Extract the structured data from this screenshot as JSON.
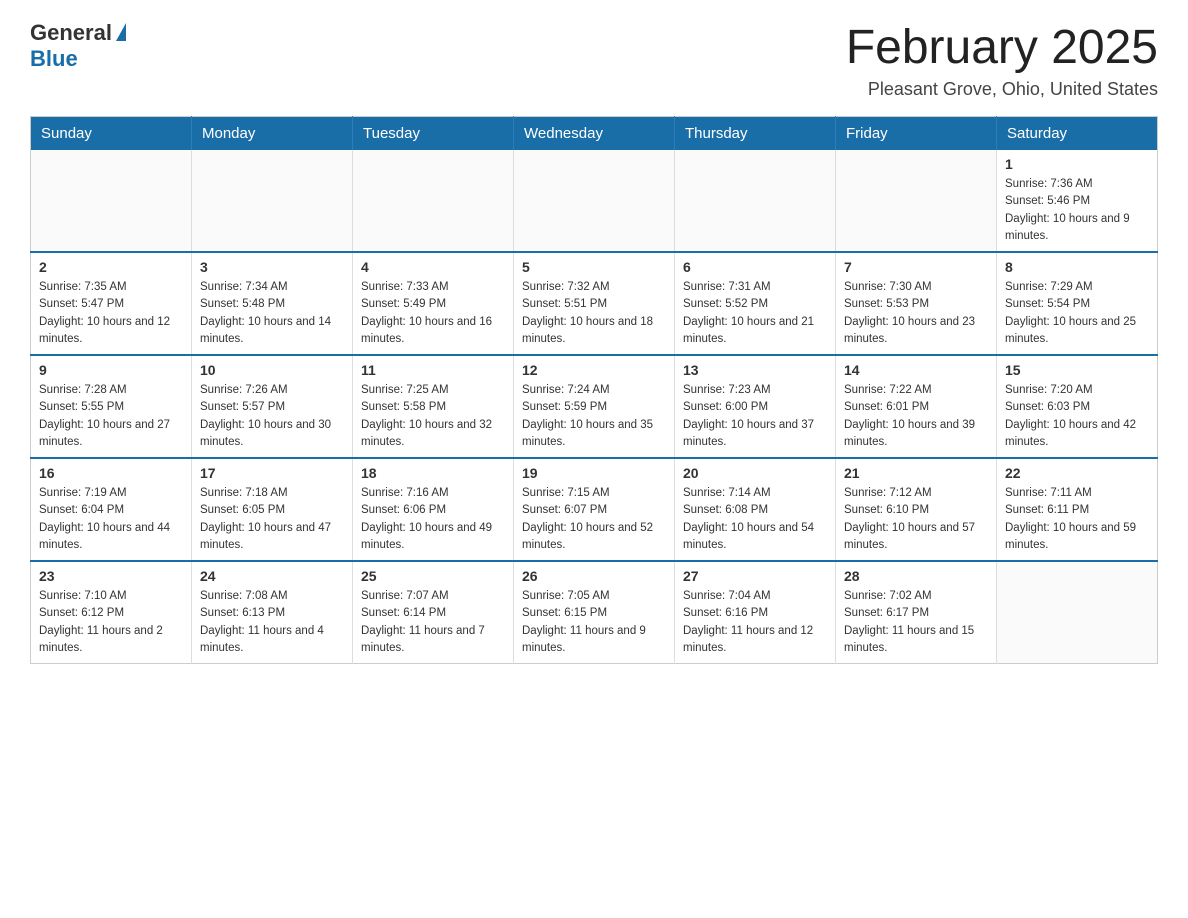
{
  "header": {
    "logo_general": "General",
    "logo_blue": "Blue",
    "title": "February 2025",
    "location": "Pleasant Grove, Ohio, United States"
  },
  "days_of_week": [
    "Sunday",
    "Monday",
    "Tuesday",
    "Wednesday",
    "Thursday",
    "Friday",
    "Saturday"
  ],
  "weeks": [
    {
      "days": [
        {
          "num": "",
          "info": ""
        },
        {
          "num": "",
          "info": ""
        },
        {
          "num": "",
          "info": ""
        },
        {
          "num": "",
          "info": ""
        },
        {
          "num": "",
          "info": ""
        },
        {
          "num": "",
          "info": ""
        },
        {
          "num": "1",
          "info": "Sunrise: 7:36 AM\nSunset: 5:46 PM\nDaylight: 10 hours and 9 minutes."
        }
      ]
    },
    {
      "days": [
        {
          "num": "2",
          "info": "Sunrise: 7:35 AM\nSunset: 5:47 PM\nDaylight: 10 hours and 12 minutes."
        },
        {
          "num": "3",
          "info": "Sunrise: 7:34 AM\nSunset: 5:48 PM\nDaylight: 10 hours and 14 minutes."
        },
        {
          "num": "4",
          "info": "Sunrise: 7:33 AM\nSunset: 5:49 PM\nDaylight: 10 hours and 16 minutes."
        },
        {
          "num": "5",
          "info": "Sunrise: 7:32 AM\nSunset: 5:51 PM\nDaylight: 10 hours and 18 minutes."
        },
        {
          "num": "6",
          "info": "Sunrise: 7:31 AM\nSunset: 5:52 PM\nDaylight: 10 hours and 21 minutes."
        },
        {
          "num": "7",
          "info": "Sunrise: 7:30 AM\nSunset: 5:53 PM\nDaylight: 10 hours and 23 minutes."
        },
        {
          "num": "8",
          "info": "Sunrise: 7:29 AM\nSunset: 5:54 PM\nDaylight: 10 hours and 25 minutes."
        }
      ]
    },
    {
      "days": [
        {
          "num": "9",
          "info": "Sunrise: 7:28 AM\nSunset: 5:55 PM\nDaylight: 10 hours and 27 minutes."
        },
        {
          "num": "10",
          "info": "Sunrise: 7:26 AM\nSunset: 5:57 PM\nDaylight: 10 hours and 30 minutes."
        },
        {
          "num": "11",
          "info": "Sunrise: 7:25 AM\nSunset: 5:58 PM\nDaylight: 10 hours and 32 minutes."
        },
        {
          "num": "12",
          "info": "Sunrise: 7:24 AM\nSunset: 5:59 PM\nDaylight: 10 hours and 35 minutes."
        },
        {
          "num": "13",
          "info": "Sunrise: 7:23 AM\nSunset: 6:00 PM\nDaylight: 10 hours and 37 minutes."
        },
        {
          "num": "14",
          "info": "Sunrise: 7:22 AM\nSunset: 6:01 PM\nDaylight: 10 hours and 39 minutes."
        },
        {
          "num": "15",
          "info": "Sunrise: 7:20 AM\nSunset: 6:03 PM\nDaylight: 10 hours and 42 minutes."
        }
      ]
    },
    {
      "days": [
        {
          "num": "16",
          "info": "Sunrise: 7:19 AM\nSunset: 6:04 PM\nDaylight: 10 hours and 44 minutes."
        },
        {
          "num": "17",
          "info": "Sunrise: 7:18 AM\nSunset: 6:05 PM\nDaylight: 10 hours and 47 minutes."
        },
        {
          "num": "18",
          "info": "Sunrise: 7:16 AM\nSunset: 6:06 PM\nDaylight: 10 hours and 49 minutes."
        },
        {
          "num": "19",
          "info": "Sunrise: 7:15 AM\nSunset: 6:07 PM\nDaylight: 10 hours and 52 minutes."
        },
        {
          "num": "20",
          "info": "Sunrise: 7:14 AM\nSunset: 6:08 PM\nDaylight: 10 hours and 54 minutes."
        },
        {
          "num": "21",
          "info": "Sunrise: 7:12 AM\nSunset: 6:10 PM\nDaylight: 10 hours and 57 minutes."
        },
        {
          "num": "22",
          "info": "Sunrise: 7:11 AM\nSunset: 6:11 PM\nDaylight: 10 hours and 59 minutes."
        }
      ]
    },
    {
      "days": [
        {
          "num": "23",
          "info": "Sunrise: 7:10 AM\nSunset: 6:12 PM\nDaylight: 11 hours and 2 minutes."
        },
        {
          "num": "24",
          "info": "Sunrise: 7:08 AM\nSunset: 6:13 PM\nDaylight: 11 hours and 4 minutes."
        },
        {
          "num": "25",
          "info": "Sunrise: 7:07 AM\nSunset: 6:14 PM\nDaylight: 11 hours and 7 minutes."
        },
        {
          "num": "26",
          "info": "Sunrise: 7:05 AM\nSunset: 6:15 PM\nDaylight: 11 hours and 9 minutes."
        },
        {
          "num": "27",
          "info": "Sunrise: 7:04 AM\nSunset: 6:16 PM\nDaylight: 11 hours and 12 minutes."
        },
        {
          "num": "28",
          "info": "Sunrise: 7:02 AM\nSunset: 6:17 PM\nDaylight: 11 hours and 15 minutes."
        },
        {
          "num": "",
          "info": ""
        }
      ]
    }
  ]
}
